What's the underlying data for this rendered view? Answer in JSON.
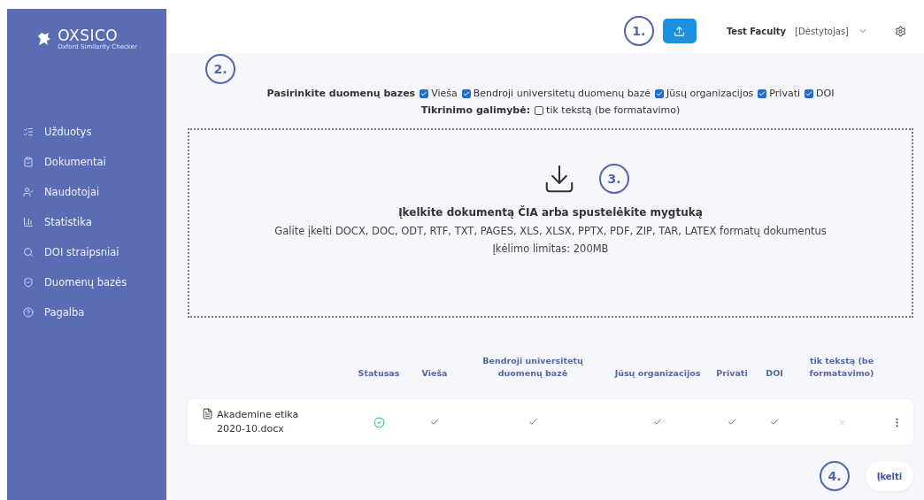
{
  "sidebar": {
    "logo": "OXSICO",
    "logo_subtitle": "Oxford Similarity Checker",
    "items": [
      {
        "label": "Užduotys"
      },
      {
        "label": "Dokumentai"
      },
      {
        "label": "Naudotojai"
      },
      {
        "label": "Statistika"
      },
      {
        "label": "DOI straipsniai"
      },
      {
        "label": "Duomenų bazės"
      },
      {
        "label": "Pagalba"
      }
    ]
  },
  "header": {
    "annotation": "1.",
    "user": "Test Faculty",
    "role": "[Dėstytojas]"
  },
  "databases": {
    "annotation": "2.",
    "label": "Pasirinkite duomenų bazes",
    "options": [
      {
        "label": "Vieša",
        "checked": true
      },
      {
        "label": "Bendroji universitetų duomenų bazė",
        "checked": true
      },
      {
        "label": "Jūsų organizacijos",
        "checked": true
      },
      {
        "label": "Privati",
        "checked": true
      },
      {
        "label": "DOI",
        "checked": true
      }
    ],
    "check_label": "Tikrinimo galimybė:",
    "check_options": [
      {
        "label": "tik tekstą (be formatavimo)",
        "checked": false
      }
    ]
  },
  "dropzone": {
    "annotation": "3.",
    "title": "Įkelkite dokumentą ČIA arba spustelėkite mygtuką",
    "formats": "Galite įkelti DOCX, DOC, ODT, RTF, TXT, PAGES, XLS, XLSX, PPTX, PDF, ZIP, TAR, LATEX formatų dokumentus",
    "limit": "Įkėlimo limitas: 200MB"
  },
  "table": {
    "columns": [
      "Statusas",
      "Vieša",
      "Bendroji universitetų duomenų bazė",
      "Jūsų organizacijos",
      "Privati",
      "DOI",
      "tik tekstą (be formatavimo)"
    ],
    "rows": [
      {
        "file": "Akademine etika 2020-10.docx",
        "status_ok": true,
        "values": [
          true,
          true,
          true,
          true,
          true,
          false
        ]
      }
    ]
  },
  "footer": {
    "annotation": "4.",
    "button": "Įkelti"
  }
}
